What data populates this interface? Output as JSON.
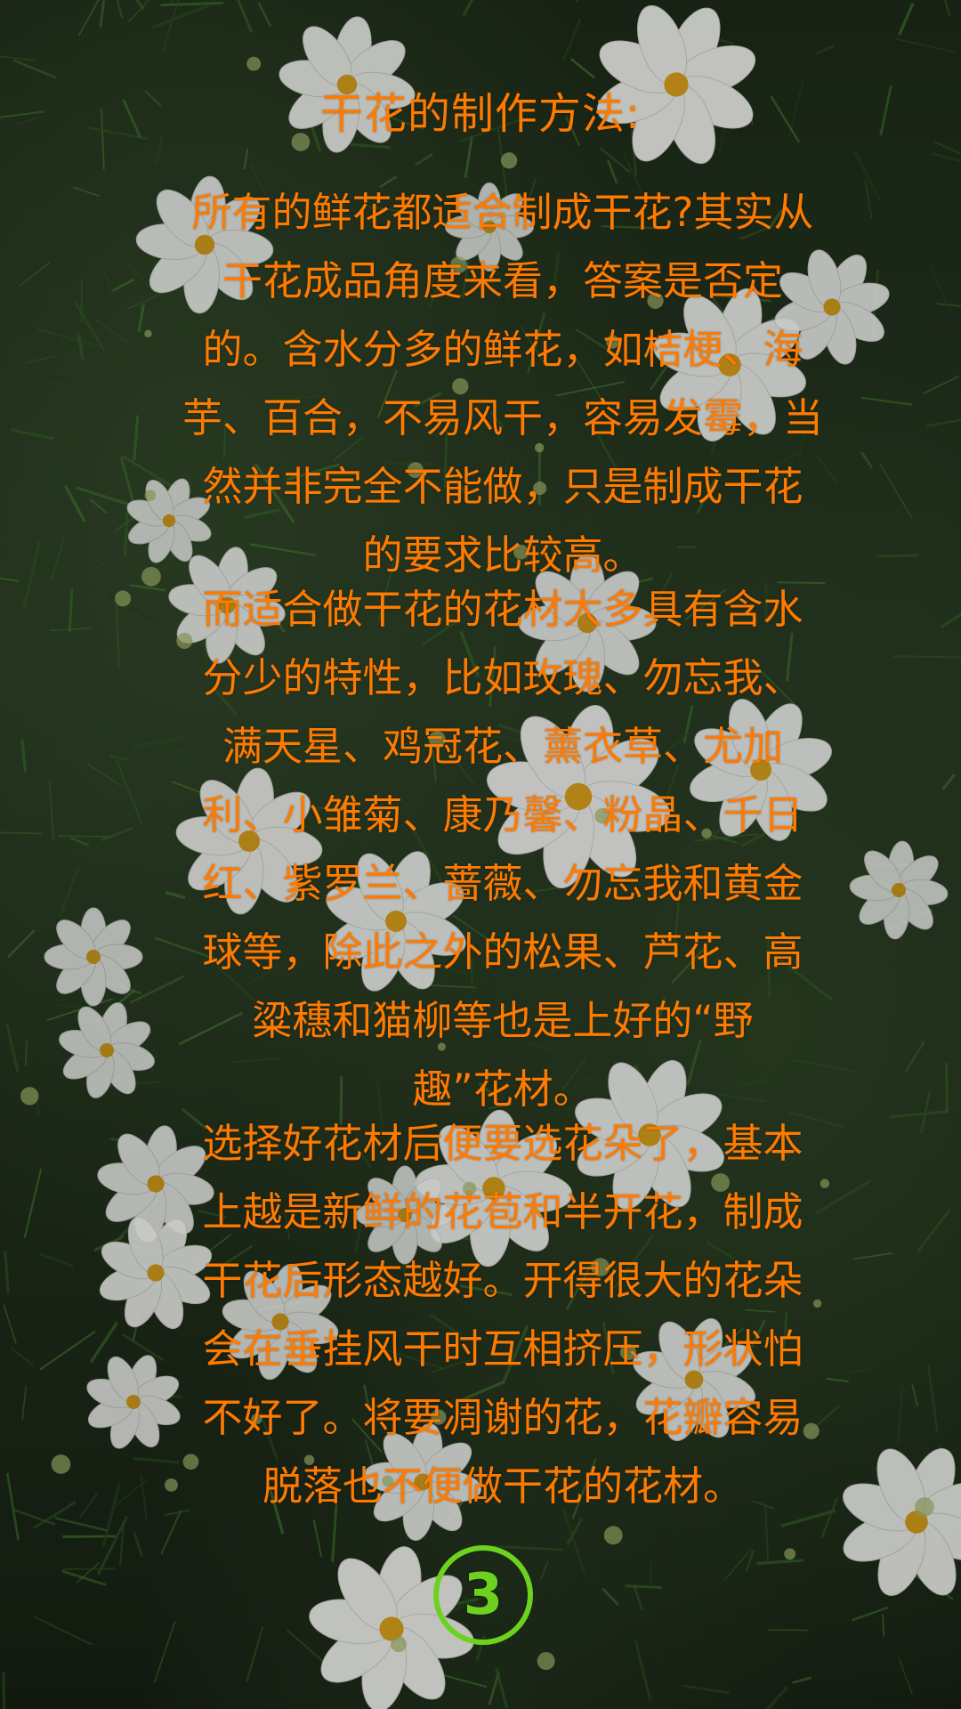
{
  "article": {
    "title": "干花的制作方法:",
    "paragraphs": [
      {
        "lines": [
          "所有的鲜花都适合制成干花?其实从",
          "干花成品角度来看，答案是否定",
          "的。含水分多的鲜花，如桔梗、海",
          "芋、百合，不易风干，容易发霉，当",
          "然并非完全不能做，只是制成干花",
          "的要求比较高。"
        ]
      },
      {
        "lines": [
          "而适合做干花的花材大多具有含水",
          "分少的特性，比如玫瑰、勿忘我、",
          "满天星、鸡冠花、薰衣草、尤加",
          "利、小雏菊、康乃馨、粉晶、千日",
          "红、紫罗兰、蔷薇、勿忘我和黄金",
          "球等，除此之外的松果、芦花、高",
          "粱穗和猫柳等也是上好的“野",
          "趣”花材。"
        ]
      },
      {
        "lines": [
          "选择好花材后便要选花朵了，基本",
          "上越是新鲜的花苞和半开花，制成",
          "干花后形态越好。开得很大的花朵",
          "会在垂挂风干时互相挤压，形状怕",
          "不好了。将要凋谢的花，花瓣容易",
          "脱落也不便做干花的花材。"
        ]
      }
    ],
    "page_number": "3"
  },
  "background": {
    "description_icon": "cosmos-flowers-photo",
    "text_color": "#ff7a00",
    "badge_color": "#6cd21f",
    "foliage_color": "#243420",
    "petal_color": "#f4f4f2",
    "center_color": "#e0a21a"
  }
}
